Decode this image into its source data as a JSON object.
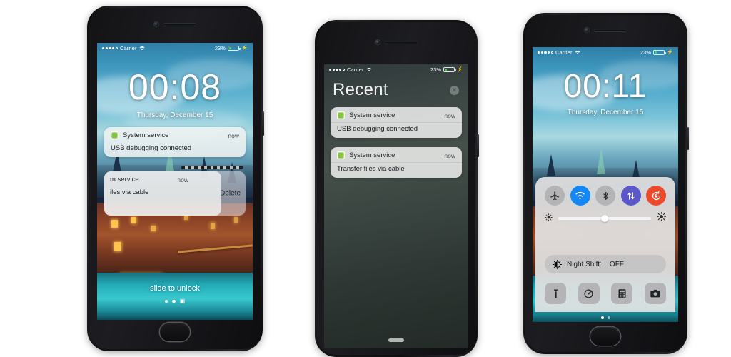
{
  "scene": {
    "description": "Three smartphones showing Android lock screen, notification center and control center"
  },
  "status_bar": {
    "carrier": "Carrier",
    "battery_percent": "23%",
    "signal_dots_filled": 4,
    "signal_dots_total": 5,
    "wifi_icon": "wifi-icon",
    "battery_icon": "battery-icon",
    "charging_icon": "lightning-bolt-icon"
  },
  "phone1": {
    "screen_name": "lock-screen",
    "clock": "00:08",
    "date": "Thursday,  December 15",
    "notifications": [
      {
        "app_icon": "system-service-icon",
        "app": "System service",
        "time": "now",
        "message": "USB debugging connected"
      },
      {
        "app_icon": "system-service-icon",
        "app": "m service",
        "time": "now",
        "message": "iles via cable",
        "swiped": true,
        "action_label": "Delete"
      }
    ],
    "unlock_text": "slide to unlock",
    "camera_icon": "camera-icon"
  },
  "phone2": {
    "screen_name": "notification-center",
    "title": "Recent",
    "clear_icon": "clear-all-icon",
    "notifications": [
      {
        "app_icon": "system-service-icon",
        "app": "System service",
        "time": "now",
        "message": "USB debugging connected"
      },
      {
        "app_icon": "system-service-icon",
        "app": "System service",
        "time": "now",
        "message": "Transfer files via cable"
      }
    ]
  },
  "phone3": {
    "screen_name": "control-center",
    "clock": "00:11",
    "date": "Thursday,  December 15",
    "toggles": [
      {
        "name": "airplane-mode-toggle",
        "icon": "airplane-icon",
        "state": "off",
        "color": "#b4b4b6"
      },
      {
        "name": "wifi-toggle",
        "icon": "wifi-icon",
        "state": "on",
        "color": "#1487f5"
      },
      {
        "name": "bluetooth-toggle",
        "icon": "bluetooth-icon",
        "state": "off",
        "color": "#b4b4b6"
      },
      {
        "name": "mobile-data-toggle",
        "icon": "data-arrows-icon",
        "state": "on",
        "color": "#5b57c9"
      },
      {
        "name": "rotation-lock-toggle",
        "icon": "rotation-lock-icon",
        "state": "on",
        "color": "#ec4a2c"
      }
    ],
    "brightness": {
      "name": "brightness-slider",
      "value_percent": 50,
      "low_icon": "sun-small-icon",
      "high_icon": "sun-large-icon"
    },
    "night_shift": {
      "icon": "night-shift-icon",
      "label": "Night Shift:",
      "value": "OFF"
    },
    "shortcuts": [
      {
        "name": "flashlight-button",
        "icon": "flashlight-icon"
      },
      {
        "name": "timer-button",
        "icon": "timer-icon"
      },
      {
        "name": "calculator-button",
        "icon": "calculator-icon"
      },
      {
        "name": "camera-button",
        "icon": "camera-icon"
      }
    ]
  },
  "colors": {
    "accent_wifi": "#1487f5",
    "accent_data": "#5b57c9",
    "accent_rotation": "#ec4a2c",
    "toggle_off": "#b4b4b6",
    "battery_green": "#4cd447",
    "app_icon_green": "#86c540"
  }
}
